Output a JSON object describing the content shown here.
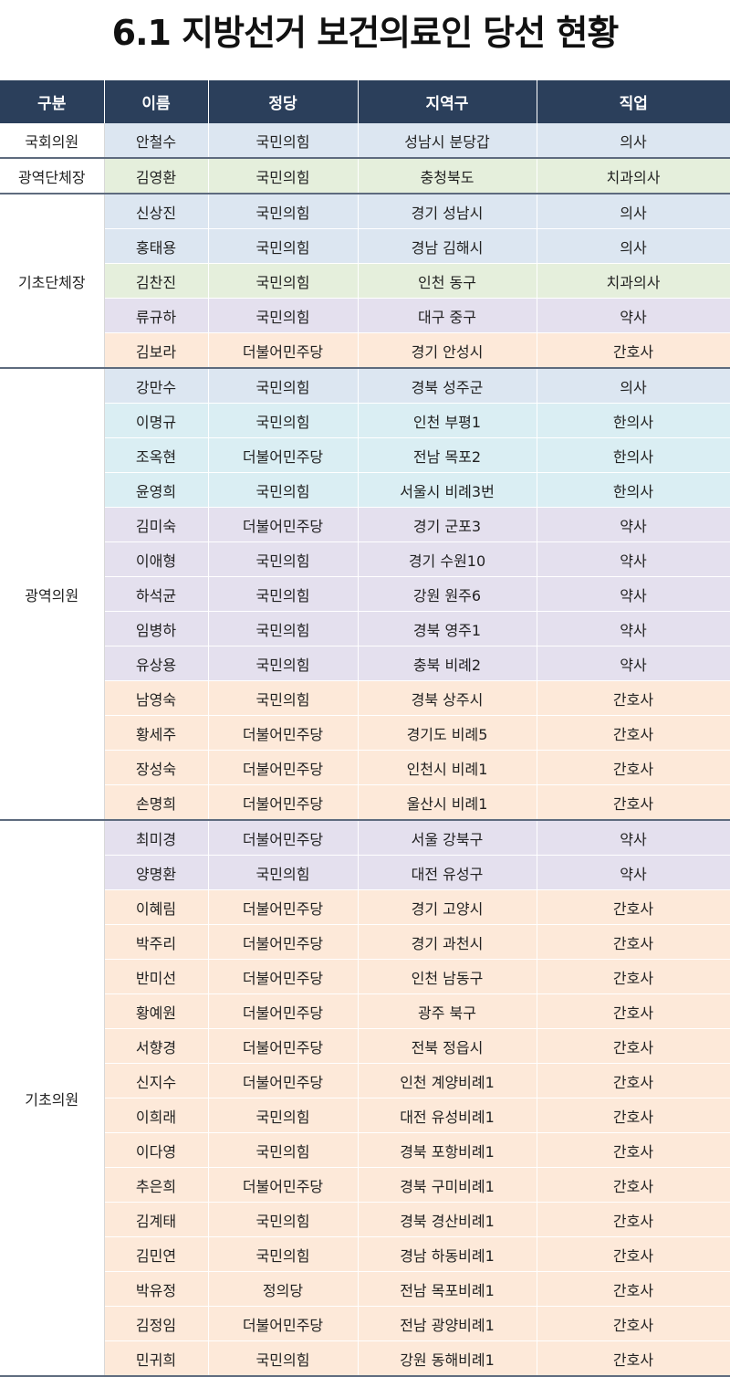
{
  "title": "6.1 지방선거 보건의료인 당선 현황",
  "headers": [
    "구분",
    "이름",
    "정당",
    "지역구",
    "직업"
  ],
  "colors": {
    "header_bg": "#2b3f5b",
    "doctor": "#dce6f1",
    "dentist": "#e5efdc",
    "pharmacist": "#e4e0ee",
    "nurse": "#fde9d9",
    "korean_medicine": "#daeef3"
  },
  "groups": [
    {
      "category": "국회의원",
      "rows": [
        {
          "name": "안철수",
          "party": "국민의힘",
          "district": "성남시 분당갑",
          "job": "의사"
        }
      ]
    },
    {
      "category": "광역단체장",
      "rows": [
        {
          "name": "김영환",
          "party": "국민의힘",
          "district": "충청북도",
          "job": "치과의사"
        }
      ]
    },
    {
      "category": "기초단체장",
      "rows": [
        {
          "name": "신상진",
          "party": "국민의힘",
          "district": "경기 성남시",
          "job": "의사"
        },
        {
          "name": "홍태용",
          "party": "국민의힘",
          "district": "경남 김해시",
          "job": "의사"
        },
        {
          "name": "김찬진",
          "party": "국민의힘",
          "district": "인천 동구",
          "job": "치과의사"
        },
        {
          "name": "류규하",
          "party": "국민의힘",
          "district": "대구 중구",
          "job": "약사"
        },
        {
          "name": "김보라",
          "party": "더불어민주당",
          "district": "경기 안성시",
          "job": "간호사"
        }
      ]
    },
    {
      "category": "광역의원",
      "rows": [
        {
          "name": "강만수",
          "party": "국민의힘",
          "district": "경북 성주군",
          "job": "의사"
        },
        {
          "name": "이명규",
          "party": "국민의힘",
          "district": "인천 부평1",
          "job": "한의사"
        },
        {
          "name": "조옥현",
          "party": "더불어민주당",
          "district": "전남 목포2",
          "job": "한의사"
        },
        {
          "name": "윤영희",
          "party": "국민의힘",
          "district": "서울시 비례3번",
          "job": "한의사"
        },
        {
          "name": "김미숙",
          "party": "더불어민주당",
          "district": "경기 군포3",
          "job": "약사"
        },
        {
          "name": "이애형",
          "party": "국민의힘",
          "district": "경기 수원10",
          "job": "약사"
        },
        {
          "name": "하석균",
          "party": "국민의힘",
          "district": "강원 원주6",
          "job": "약사"
        },
        {
          "name": "임병하",
          "party": "국민의힘",
          "district": "경북 영주1",
          "job": "약사"
        },
        {
          "name": "유상용",
          "party": "국민의힘",
          "district": "충북 비례2",
          "job": "약사"
        },
        {
          "name": "남영숙",
          "party": "국민의힘",
          "district": "경북 상주시",
          "job": "간호사"
        },
        {
          "name": "황세주",
          "party": "더불어민주당",
          "district": "경기도 비례5",
          "job": "간호사"
        },
        {
          "name": "장성숙",
          "party": "더불어민주당",
          "district": "인천시 비례1",
          "job": "간호사"
        },
        {
          "name": "손명희",
          "party": "더불어민주당",
          "district": "울산시 비례1",
          "job": "간호사"
        }
      ]
    },
    {
      "category": "기초의원",
      "rows": [
        {
          "name": "최미경",
          "party": "더불어민주당",
          "district": "서울 강북구",
          "job": "약사"
        },
        {
          "name": "양명환",
          "party": "국민의힘",
          "district": "대전 유성구",
          "job": "약사"
        },
        {
          "name": "이혜림",
          "party": "더불어민주당",
          "district": "경기 고양시",
          "job": "간호사"
        },
        {
          "name": "박주리",
          "party": "더불어민주당",
          "district": "경기 과천시",
          "job": "간호사"
        },
        {
          "name": "반미선",
          "party": "더불어민주당",
          "district": "인천 남동구",
          "job": "간호사"
        },
        {
          "name": "황예원",
          "party": "더불어민주당",
          "district": "광주 북구",
          "job": "간호사"
        },
        {
          "name": "서향경",
          "party": "더불어민주당",
          "district": "전북 정읍시",
          "job": "간호사"
        },
        {
          "name": "신지수",
          "party": "더불어민주당",
          "district": "인천 계양비례1",
          "job": "간호사"
        },
        {
          "name": "이희래",
          "party": "국민의힘",
          "district": "대전 유성비례1",
          "job": "간호사"
        },
        {
          "name": "이다영",
          "party": "국민의힘",
          "district": "경북 포항비례1",
          "job": "간호사"
        },
        {
          "name": "추은희",
          "party": "더불어민주당",
          "district": "경북 구미비례1",
          "job": "간호사"
        },
        {
          "name": "김계태",
          "party": "국민의힘",
          "district": "경북 경산비례1",
          "job": "간호사"
        },
        {
          "name": "김민연",
          "party": "국민의힘",
          "district": "경남 하동비례1",
          "job": "간호사"
        },
        {
          "name": "박유정",
          "party": "정의당",
          "district": "전남 목포비례1",
          "job": "간호사"
        },
        {
          "name": "김정임",
          "party": "더불어민주당",
          "district": "전남 광양비례1",
          "job": "간호사"
        },
        {
          "name": "민귀희",
          "party": "국민의힘",
          "district": "강원 동해비례1",
          "job": "간호사"
        }
      ]
    }
  ]
}
